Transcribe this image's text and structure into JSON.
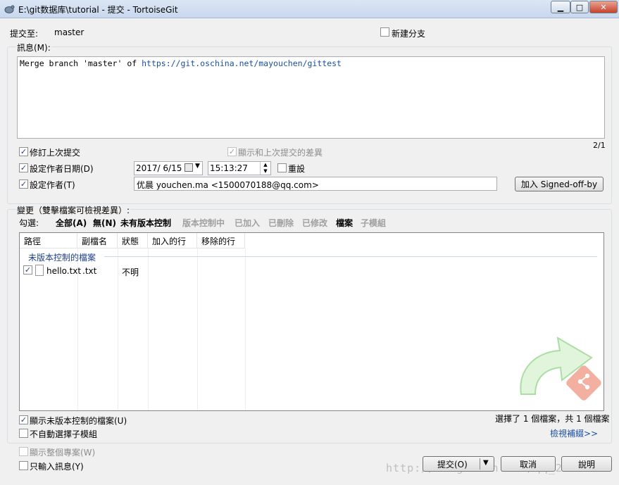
{
  "window": {
    "title": "E:\\git数据库\\tutorial - 提交 - TortoiseGit",
    "minimize": "▁",
    "maximize": "□",
    "close": "✕"
  },
  "commit_to": {
    "label": "提交至:",
    "branch": "master"
  },
  "new_branch": {
    "label": "新建分支",
    "checked": false
  },
  "message": {
    "label": "訊息(M):",
    "text_prefix": "Merge branch 'master' of ",
    "text_link": "https://git.oschina.net/mayouchen/gittest",
    "counter": "2/1"
  },
  "options": {
    "amend": {
      "label": "修訂上次提交",
      "checked": true
    },
    "show_diff": {
      "label": "顯示和上次提交的差異",
      "checked": true,
      "disabled": true
    },
    "set_date": {
      "label": "設定作者日期(D)",
      "checked": true
    },
    "date_value": "2017/ 6/15",
    "time_value": "15:13:27",
    "reset": {
      "label": "重設",
      "checked": false
    },
    "set_author": {
      "label": "設定作者(T)",
      "checked": true
    },
    "author_value": "优晨 youchen.ma <1500070188@qq.com>",
    "signoff_button": "加入 Signed-off-by"
  },
  "changes": {
    "label": "變更（雙擊檔案可檢視差異）:",
    "select_label": "勾選:",
    "filters": [
      {
        "label": "全部(A)",
        "enabled": true
      },
      {
        "label": "無(N)",
        "enabled": true
      },
      {
        "label": "未有版本控制",
        "enabled": true
      },
      {
        "label": "版本控制中",
        "enabled": false
      },
      {
        "label": "已加入",
        "enabled": false
      },
      {
        "label": "已刪除",
        "enabled": false
      },
      {
        "label": "已修改",
        "enabled": false
      },
      {
        "label": "檔案",
        "enabled": true
      },
      {
        "label": "子模組",
        "enabled": false
      }
    ],
    "columns": [
      "路徑",
      "副檔名",
      "狀態",
      "加入的行",
      "移除的行"
    ],
    "group_label": "未版本控制的檔案",
    "rows": [
      {
        "path": "hello.txt",
        "ext": ".txt",
        "status": "不明",
        "checked": true
      }
    ],
    "summary": "選擇了 1 個檔案，共 1 個檔案",
    "view_patch": "檢視補綴>>"
  },
  "bottom_options": {
    "show_unversioned": {
      "label": "顯示未版本控制的檔案(U)",
      "checked": true
    },
    "no_auto_submodule": {
      "label": "不自動選擇子模組",
      "checked": false
    },
    "show_whole_project": {
      "label": "顯示整個專案(W)",
      "checked": false,
      "disabled": true
    },
    "message_only": {
      "label": "只輸入訊息(Y)",
      "checked": false
    }
  },
  "buttons": {
    "commit": "提交(O)",
    "dropdown": "▼",
    "cancel": "取消",
    "help": "說明"
  },
  "watermark": "http://blog.csdn.net/qq_24147051",
  "colors": {
    "link": "#1a4fa1",
    "accent_green": "#4fc24f",
    "git_red": "#e05a3a"
  }
}
